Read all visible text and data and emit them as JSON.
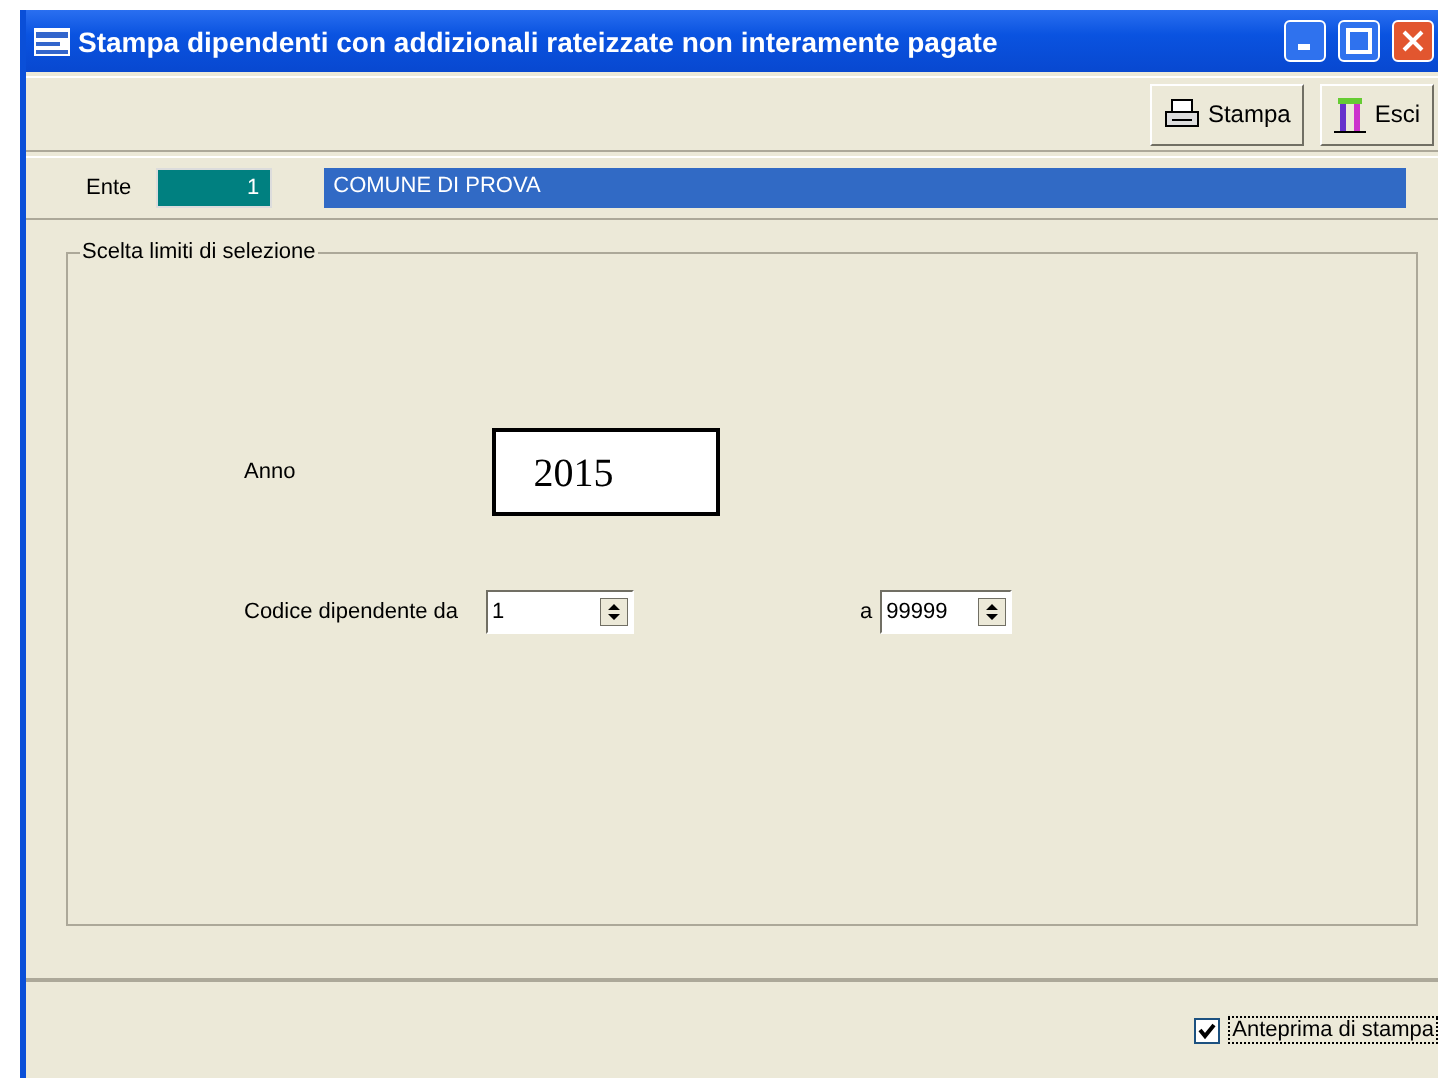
{
  "window": {
    "title": "Stampa dipendenti con addizionali rateizzate non interamente pagate"
  },
  "toolbar": {
    "buttons": [
      {
        "kind": "print",
        "label": "Stampa"
      },
      {
        "kind": "exit",
        "label": "Esci"
      }
    ]
  },
  "ente": {
    "label": "Ente",
    "code": "1",
    "name": "COMUNE DI PROVA"
  },
  "group": {
    "title": "Scelta limiti di selezione",
    "anno": {
      "label": "Anno",
      "value": "2015"
    },
    "codice": {
      "label": "Codice dipendente da",
      "from": "1",
      "to_label": "a",
      "to": "99999"
    }
  },
  "footer": {
    "preview": {
      "label": "Anteprima di stampa",
      "checked": true
    }
  }
}
